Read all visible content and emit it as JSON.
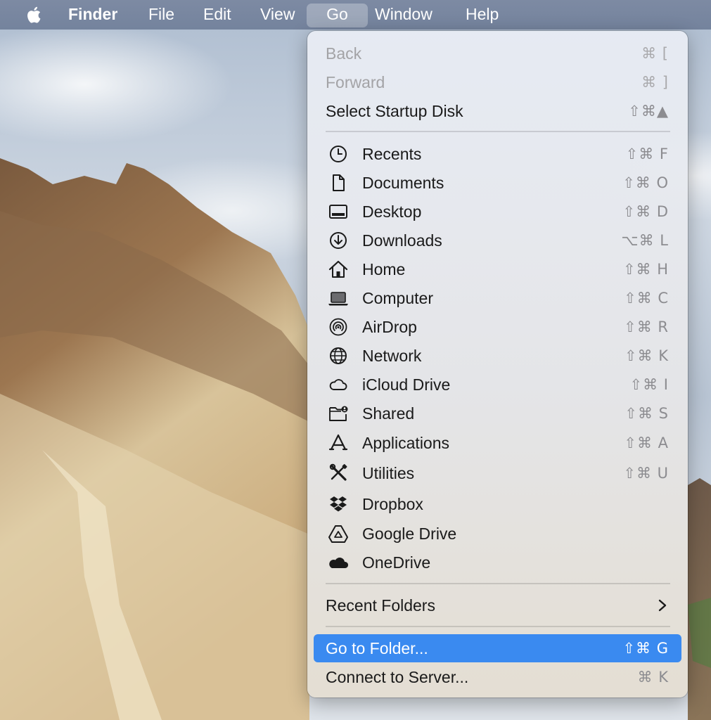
{
  "menubar": {
    "apple_icon": "apple-logo-icon",
    "items": [
      {
        "label": "Finder"
      },
      {
        "label": "File"
      },
      {
        "label": "Edit"
      },
      {
        "label": "View"
      },
      {
        "label": "Go"
      },
      {
        "label": "Window"
      },
      {
        "label": "Help"
      }
    ],
    "active_item": "Go"
  },
  "go_menu": {
    "top": [
      {
        "label": "Back",
        "shortcut": "⌘ [",
        "disabled": true
      },
      {
        "label": "Forward",
        "shortcut": "⌘ ]",
        "disabled": true
      },
      {
        "label": "Select Startup Disk",
        "shortcut": "⇧⌘▲",
        "disabled": false
      }
    ],
    "places": [
      {
        "label": "Recents",
        "shortcut": "⇧⌘ F",
        "icon": "clock-icon"
      },
      {
        "label": "Documents",
        "shortcut": "⇧⌘ O",
        "icon": "document-icon"
      },
      {
        "label": "Desktop",
        "shortcut": "⇧⌘ D",
        "icon": "desktop-icon"
      },
      {
        "label": "Downloads",
        "shortcut": "⌥⌘ L",
        "icon": "download-icon"
      },
      {
        "label": "Home",
        "shortcut": "⇧⌘ H",
        "icon": "home-icon"
      },
      {
        "label": "Computer",
        "shortcut": "⇧⌘ C",
        "icon": "laptop-icon"
      },
      {
        "label": "AirDrop",
        "shortcut": "⇧⌘ R",
        "icon": "airdrop-icon"
      },
      {
        "label": "Network",
        "shortcut": "⇧⌘ K",
        "icon": "globe-icon"
      },
      {
        "label": "iCloud Drive",
        "shortcut": "⇧⌘ I",
        "icon": "cloud-icon"
      },
      {
        "label": "Shared",
        "shortcut": "⇧⌘ S",
        "icon": "shared-folder-icon"
      },
      {
        "label": "Applications",
        "shortcut": "⇧⌘ A",
        "icon": "applications-icon"
      },
      {
        "label": "Utilities",
        "shortcut": "⇧⌘ U",
        "icon": "utilities-icon"
      },
      {
        "label": "Dropbox",
        "shortcut": "",
        "icon": "dropbox-icon"
      },
      {
        "label": "Google Drive",
        "shortcut": "",
        "icon": "google-drive-icon"
      },
      {
        "label": "OneDrive",
        "shortcut": "",
        "icon": "onedrive-icon"
      }
    ],
    "recent_folders": {
      "label": "Recent Folders",
      "icon": "chevron-right-icon"
    },
    "bottom": [
      {
        "label": "Go to Folder...",
        "shortcut": "⇧⌘ G",
        "highlighted": true
      },
      {
        "label": "Connect to Server...",
        "shortcut": "⌘ K",
        "highlighted": false
      }
    ],
    "highlight_color": "#3a8af0"
  }
}
